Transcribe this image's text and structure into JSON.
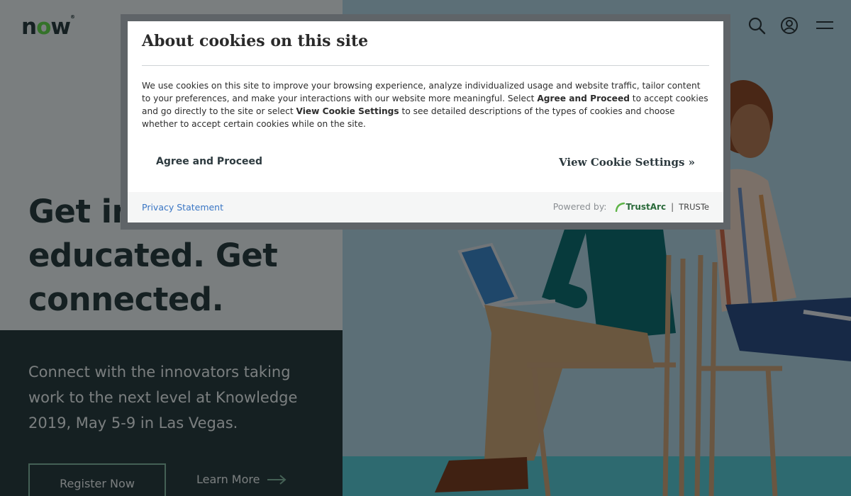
{
  "header": {
    "logo_text_n": "n",
    "logo_text_o": "o",
    "logo_text_w": "w",
    "logo_tm": "®",
    "icons": [
      "search-icon",
      "user-account-icon",
      "hamburger-menu-icon"
    ]
  },
  "hero": {
    "headline": "Get inspired. Get educated. Get connected.",
    "subcopy": "Connect with the innovators taking work to the next level at Knowledge 2019, May 5-9 in Las Vegas.",
    "register_label": "Register Now",
    "learn_more_label": "Learn More"
  },
  "cookie_dialog": {
    "title": "About cookies on this site",
    "body_part1": "We use cookies on this site to improve your browsing experience, analyze individualized usage and website traffic, tailor content to your preferences, and make your interactions with our website more meaningful. Select ",
    "body_bold1": "Agree and Proceed",
    "body_part2": " to accept cookies and go directly to the site or select ",
    "body_bold2": "View Cookie Settings",
    "body_part3": " to see detailed descriptions of the types of cookies and choose whether to accept certain cookies while on the site.",
    "agree_label": "Agree and Proceed",
    "settings_label": "View Cookie Settings »",
    "privacy_label": "Privacy Statement",
    "powered_by": "Powered by:",
    "trustarc_label": "TrustArc",
    "truste_label": "TRUSTe"
  },
  "colors": {
    "brand_dark": "#293e40",
    "brand_green": "#62d84e",
    "link_blue": "#3a76c4"
  }
}
